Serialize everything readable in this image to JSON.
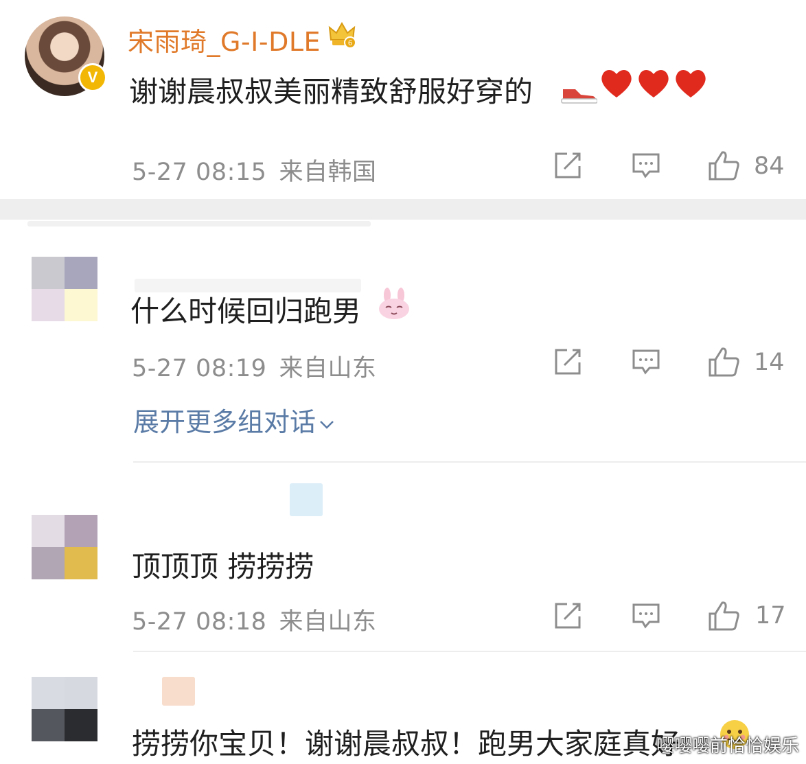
{
  "comments": [
    {
      "username": "宋雨琦_G-I-DLE",
      "badge_letter": "V",
      "text": "谢谢晨叔叔美丽精致舒服好穿的",
      "time": "5-27 08:15",
      "location": "来自韩国",
      "likes": "84"
    },
    {
      "text": "什么时候回归跑男",
      "time": "5-27 08:19",
      "location": "来自山东",
      "likes": "14",
      "expand_label": "展开更多组对话"
    },
    {
      "text": "顶顶顶 捞捞捞",
      "time": "5-27 08:18",
      "location": "来自山东",
      "likes": "17"
    },
    {
      "text": "捞捞你宝贝！谢谢晨叔叔！跑男大家庭真好"
    }
  ],
  "watermark": "嘤嘤嘤前恰恰娱乐",
  "colors": {
    "username": "#e07a2a",
    "link": "#5a7ba6",
    "meta": "#8d8d8d",
    "heart": "#e02a1e"
  },
  "icons": [
    "verified-v-icon",
    "crown-badge-icon",
    "sneaker-icon",
    "heart-icon",
    "repost-icon",
    "comment-icon",
    "thumbs-up-icon",
    "bunny-emoji-icon",
    "chevron-down-icon",
    "emoji-icon"
  ]
}
